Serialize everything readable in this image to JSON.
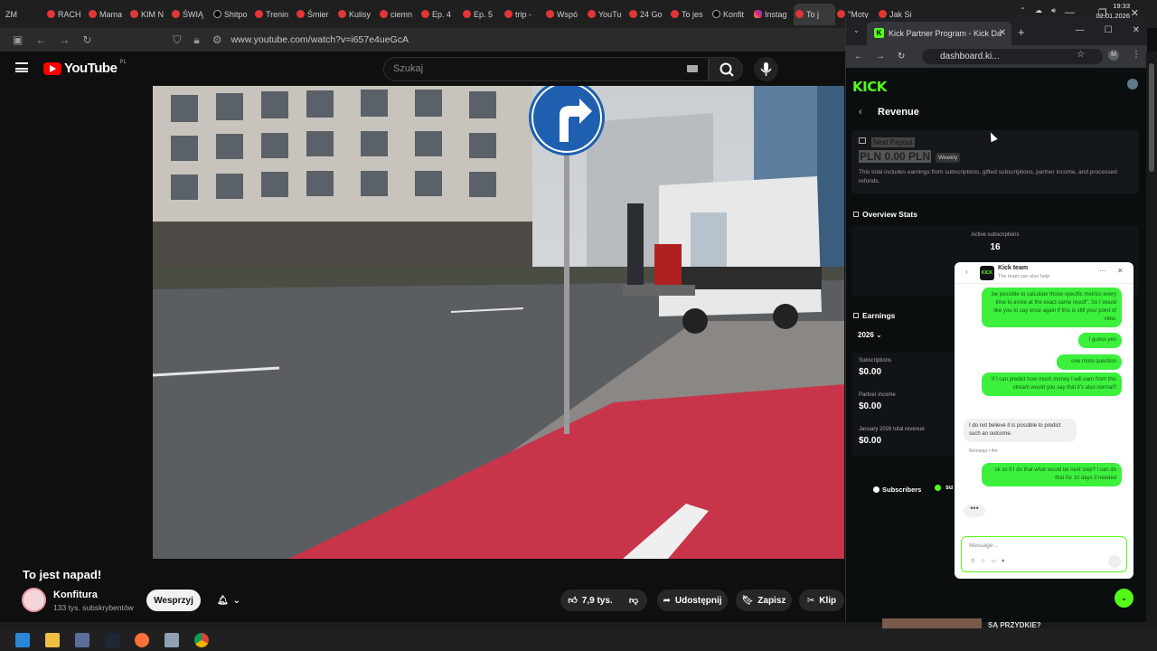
{
  "browser_tabs": [
    {
      "label": "ZM",
      "icon": "none"
    },
    {
      "label": "RACH",
      "icon": "youtube-icon"
    },
    {
      "label": "Mama",
      "icon": "youtube-icon"
    },
    {
      "label": "KIM N",
      "icon": "youtube-icon"
    },
    {
      "label": "ŚWIĄ",
      "icon": "youtube-icon"
    },
    {
      "label": "Shitpo",
      "icon": "x-icon"
    },
    {
      "label": "Trenin",
      "icon": "youtube-icon"
    },
    {
      "label": "Śmier",
      "icon": "youtube-icon"
    },
    {
      "label": "Kulisy",
      "icon": "youtube-icon"
    },
    {
      "label": "ciemn",
      "icon": "youtube-icon"
    },
    {
      "label": "Ep. 4",
      "icon": "youtube-icon"
    },
    {
      "label": "Ep. 5",
      "icon": "youtube-icon"
    },
    {
      "label": "trip -",
      "icon": "youtube-icon"
    },
    {
      "label": "Wspó",
      "icon": "youtube-icon"
    },
    {
      "label": "YouTu",
      "icon": "youtube-icon"
    },
    {
      "label": "24 Go",
      "icon": "youtube-icon"
    },
    {
      "label": "To jes",
      "icon": "youtube-icon"
    },
    {
      "label": "Konfit",
      "icon": "x-icon"
    },
    {
      "label": "Instag",
      "icon": "instagram-icon"
    },
    {
      "label": "To j",
      "icon": "speaker-icon",
      "active": true
    },
    {
      "label": "\"Moty",
      "icon": "youtube-icon"
    },
    {
      "label": "Jak Si",
      "icon": "youtube-icon"
    }
  ],
  "address": {
    "url": "www.youtube.com/watch?v=i657e4ueGcA"
  },
  "youtube": {
    "logo_text": "YouTube",
    "region": "PL",
    "search_placeholder": "Szukaj",
    "video_title": "To jest napad!",
    "channel_name": "Konfitura",
    "channel_subs": "133 tys. subskrybentów",
    "support_label": "Wesprzyj",
    "like_count": "7,9 tys.",
    "share_label": "Udostępnij",
    "save_label": "Zapisz",
    "clip_label": "Klip"
  },
  "kick_window": {
    "tab_title": "Kick Partner Program - Kick Da",
    "url": "dashboard.ki...",
    "logo": "KICK",
    "page_title": "Revenue",
    "payout_label": "Next Payout",
    "payout_amount": "PLN 0.00 PLN",
    "payout_badge": "Weekly",
    "payout_desc": "This total includes earnings from subscriptions, gifted subscriptions, partner income, and processed refunds.",
    "overview_title": "Overview Stats",
    "active_subs_label": "Active subscriptions",
    "active_subs_value": "16",
    "earnings_title": "Earnings",
    "year": "2026",
    "earnings": [
      {
        "label": "Subscriptions",
        "value": "$0.00"
      },
      {
        "label": "Partner income",
        "value": "$0.00"
      },
      {
        "label": "January 2026 total revenue",
        "value": "$0.00"
      }
    ],
    "legend_subscribers": "Subscribers",
    "legend_other": "su"
  },
  "chat": {
    "team_name": "Kick team",
    "team_sub": "The team can also help",
    "messages": [
      {
        "from": "me",
        "text": "be possible to calculate those specific metrics every time to arrive at the exact same result\". So I would like you to say once again if this is still your point of view."
      },
      {
        "from": "me",
        "text": "I guess yes"
      },
      {
        "from": "me",
        "text": "one more question"
      },
      {
        "from": "me",
        "text": "If I can predict how much money I will earn from this stream would you say that it's also normal?"
      },
      {
        "from": "them",
        "text": "I do not believe it is possible to predict such an outcome."
      },
      {
        "from": "me",
        "text": "ok so if I do that what would be next step? I can do that for 10 days if needed"
      }
    ],
    "author_meta": "Nemanja • 4m",
    "input_placeholder": "Message..."
  },
  "bottom_strip": {
    "text": "SĄ PRZYDKIE?"
  },
  "taskbar": {
    "time": "19:33",
    "date": "02.01.2026"
  }
}
